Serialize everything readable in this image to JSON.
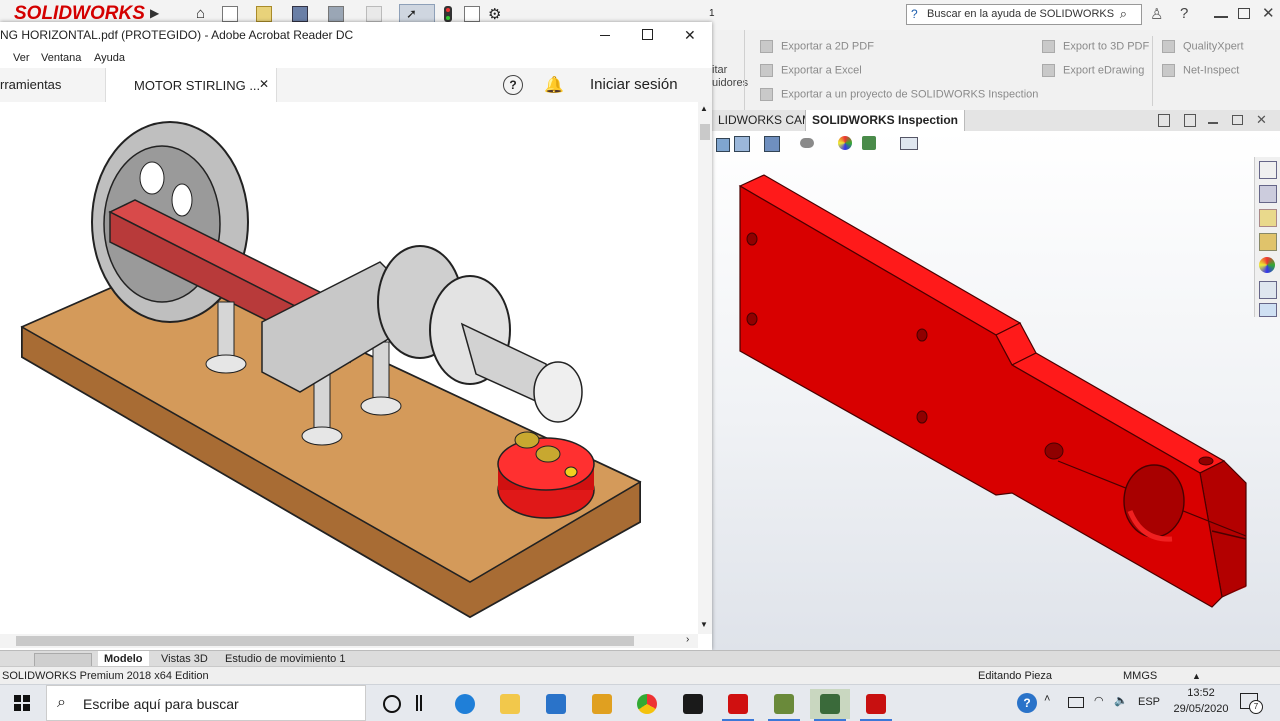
{
  "solidworks": {
    "logo": "SOLIDWORKS",
    "counter": "1",
    "search_placeholder": "Buscar en la ayuda de SOLIDWORKS",
    "ribbon": {
      "partial_label_1": "itar",
      "partial_label_2": "uidores",
      "export_2d_pdf": "Exportar a 2D PDF",
      "export_excel": "Exportar a Excel",
      "export_project": "Exportar a un proyecto de SOLIDWORKS Inspection",
      "export_3d_pdf": "Export to 3D PDF",
      "export_edrawing": "Export eDrawing",
      "qualityxpert": "QualityXpert",
      "net_inspect": "Net-Inspect"
    },
    "tabs": [
      "LIDWORKS CAM",
      "SOLIDWORKS Inspection"
    ],
    "model_tabs": [
      "Modelo",
      "Vistas 3D",
      "Estudio de movimiento 1"
    ],
    "status": {
      "edition": "SOLIDWORKS Premium 2018 x64 Edition",
      "editing": "Editando Pieza",
      "units": "MMGS"
    },
    "part_color": "#cc0000"
  },
  "acrobat": {
    "title": "NG HORIZONTAL.pdf (PROTEGIDO) - Adobe Acrobat Reader DC",
    "menu": [
      "Ver",
      "Ventana",
      "Ayuda"
    ],
    "tab_tools": "rramientas",
    "tab_doc": "MOTOR STIRLING ...",
    "signin": "Iniciar sesión"
  },
  "taskbar": {
    "search_placeholder": "Escribe aquí para buscar",
    "language": "ESP",
    "time": "13:52",
    "date": "29/05/2020",
    "notifications": "7"
  },
  "icons": [
    "windows-start-icon",
    "search-icon",
    "cortana-icon",
    "task-view-icon",
    "edge-icon",
    "explorer-icon",
    "mail-icon",
    "sketch-icon",
    "chrome-icon",
    "dropbox-icon",
    "acrobat-icon",
    "solidworks-icon"
  ]
}
